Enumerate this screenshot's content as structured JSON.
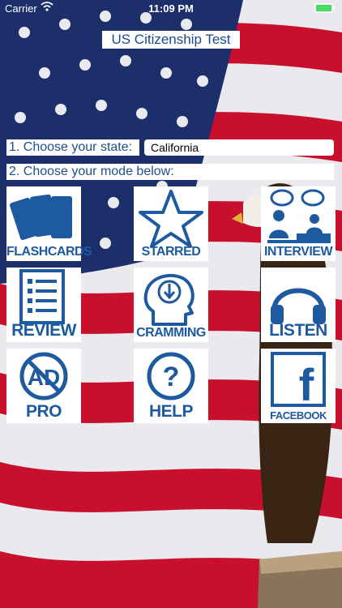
{
  "status_bar": {
    "carrier": "Carrier",
    "time": "11:09 PM"
  },
  "app": {
    "title": "US Citizenship Test"
  },
  "steps": {
    "state_label": "1. Choose your state:",
    "state_value": "California",
    "mode_label": "2. Choose your mode below:"
  },
  "tiles": {
    "flashcards": "FLASHCARDS",
    "starred": "STARRED",
    "interview": "INTERVIEW",
    "review": "REVIEW",
    "cramming": "CRAMMING",
    "listen": "LISTEN",
    "pro": "PRO",
    "help": "HELP",
    "facebook": "FACEBOOK"
  },
  "icons": {
    "pro_glyph": "AD",
    "help_glyph": "?",
    "facebook_glyph": "f"
  },
  "colors": {
    "icon_blue": "#1e5aa0",
    "flag_red": "#c8102e",
    "flag_blue": "#1c2f6b"
  }
}
